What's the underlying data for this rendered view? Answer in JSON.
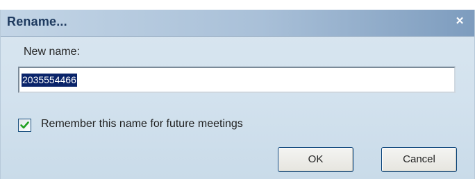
{
  "dialog": {
    "title": "Rename...",
    "close_icon": "close-icon",
    "close_glyph": "×",
    "new_name_label": "New name:",
    "name_value": "2035554466",
    "remember_checked": true,
    "remember_label": "Remember this name for future meetings",
    "ok_label": "OK",
    "cancel_label": "Cancel"
  },
  "colors": {
    "title_text": "#1e3a5f",
    "selection_bg": "#0a246a",
    "checkmark": "#21a121"
  }
}
